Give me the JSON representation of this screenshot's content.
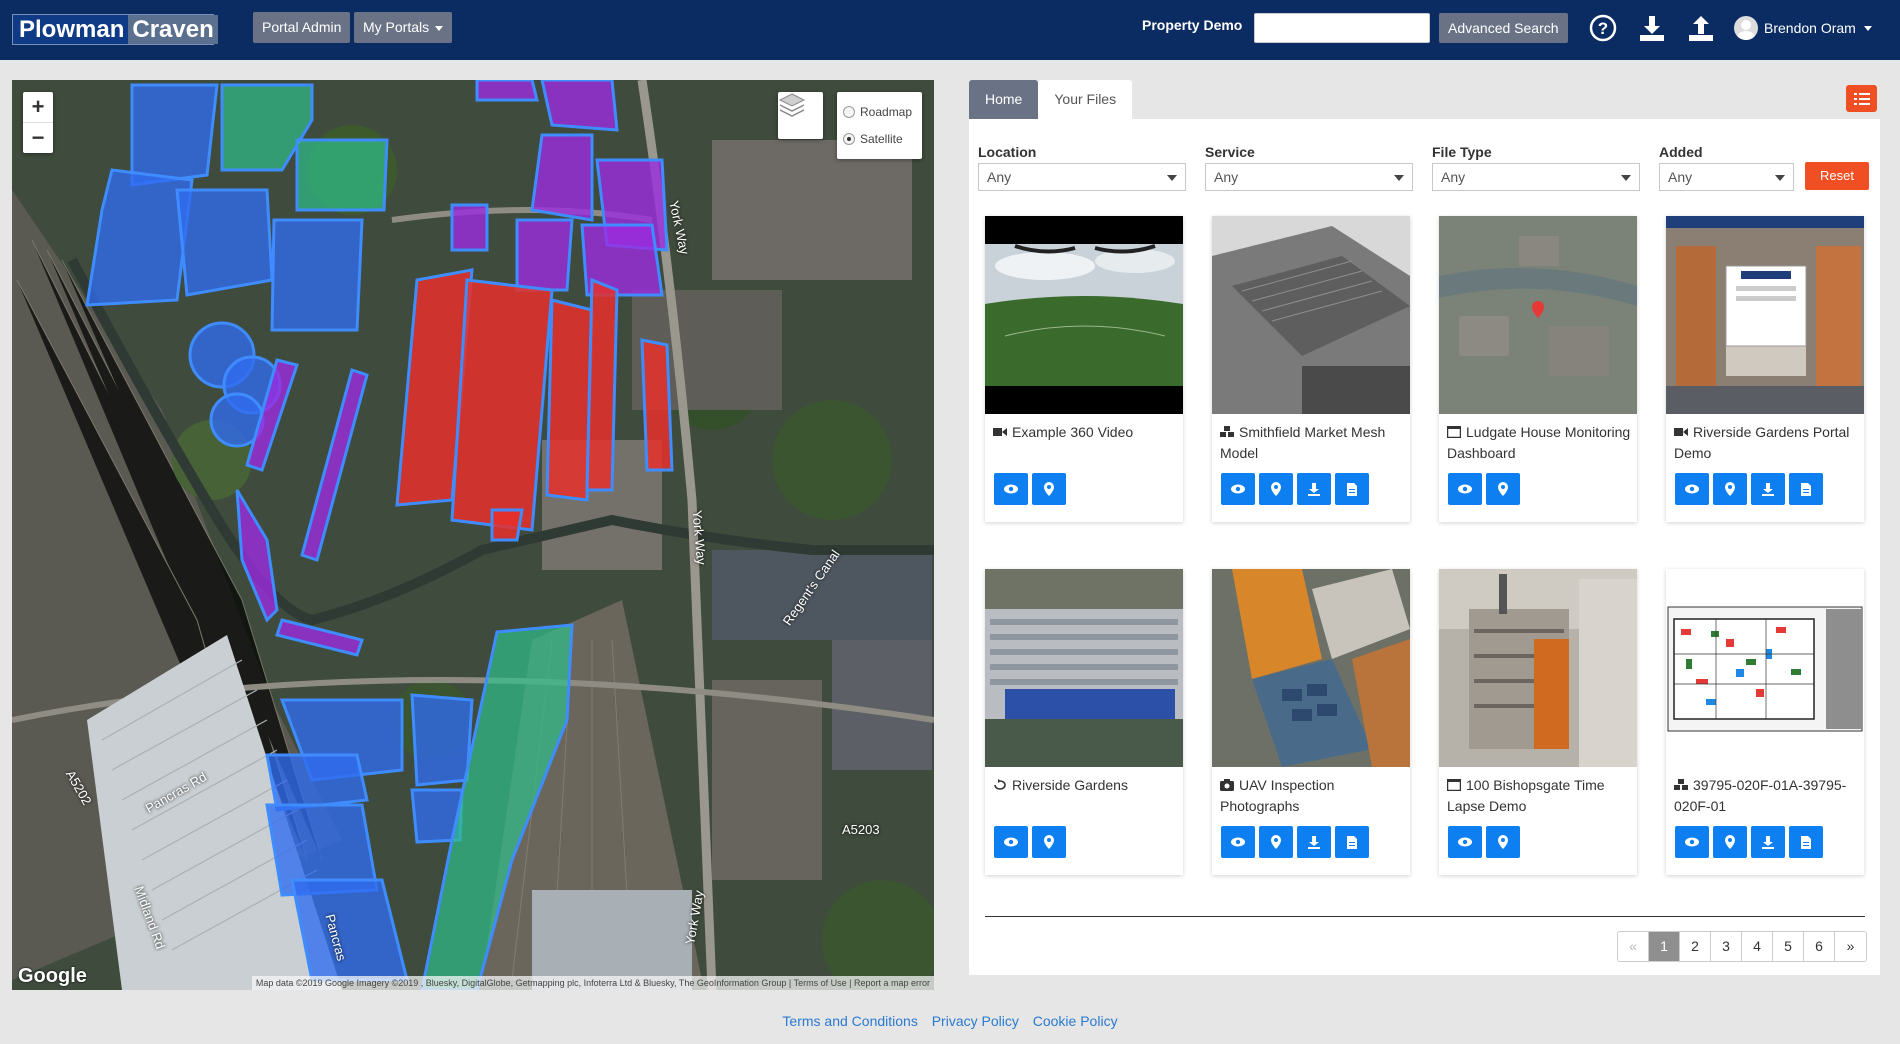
{
  "header": {
    "logo_word1": "Plowman",
    "logo_word2": "Craven",
    "portal_admin": "Portal Admin",
    "my_portals": "My Portals",
    "property_label": "Property Demo",
    "search_value": "",
    "advanced_search": "Advanced Search",
    "user_name": "Brendon Oram",
    "icons": [
      "help-icon",
      "download-icon",
      "upload-icon",
      "user-avatar-icon"
    ]
  },
  "map": {
    "zoom_in": "+",
    "zoom_out": "−",
    "layer_options": [
      "Roadmap",
      "Satellite"
    ],
    "selected_layer": "Satellite",
    "labels": [
      "York Way",
      "York Way",
      "York Way",
      "Regent's Canal",
      "A5203",
      "A5202",
      "Pancras Rd",
      "Midland Rd",
      "Pancras"
    ],
    "google": "Google",
    "attribution": "Map data ©2019 Google Imagery ©2019 , Bluesky, DigitalGlobe, Getmapping plc, Infoterra Ltd & Bluesky, The GeoInformation Group",
    "terms": "Terms of Use",
    "report": "Report a map error"
  },
  "tabs": [
    {
      "label": "Home",
      "active": true
    },
    {
      "label": "Your Files",
      "active": false
    }
  ],
  "filters": [
    {
      "label": "Location",
      "value": "Any"
    },
    {
      "label": "Service",
      "value": "Any"
    },
    {
      "label": "File Type",
      "value": "Any"
    },
    {
      "label": "Added",
      "value": "Any"
    }
  ],
  "reset_label": "Reset",
  "files": [
    {
      "title": "Example 360 Video",
      "icon": "video-icon",
      "actions": [
        "view",
        "locate"
      ]
    },
    {
      "title": "Smithfield Market Mesh Model",
      "icon": "cubes-icon",
      "actions": [
        "view",
        "locate",
        "download",
        "document"
      ]
    },
    {
      "title": "Ludgate House Monitoring Dashboard",
      "icon": "window-icon",
      "actions": [
        "view",
        "locate"
      ]
    },
    {
      "title": "Riverside Gardens Portal Demo",
      "icon": "video-icon",
      "actions": [
        "view",
        "locate",
        "download",
        "document"
      ]
    },
    {
      "title": "Riverside Gardens",
      "icon": "rotate-icon",
      "actions": [
        "view",
        "locate"
      ]
    },
    {
      "title": "UAV Inspection Photographs",
      "icon": "camera-icon",
      "actions": [
        "view",
        "locate",
        "download",
        "document"
      ]
    },
    {
      "title": "100 Bishopsgate Time Lapse Demo",
      "icon": "window-icon",
      "actions": [
        "view",
        "locate"
      ]
    },
    {
      "title": "39795-020F-01A-39795-020F-01",
      "icon": "cubes-icon",
      "actions": [
        "view",
        "locate",
        "download",
        "document"
      ]
    }
  ],
  "pagination": {
    "prev": "«",
    "pages": [
      "1",
      "2",
      "3",
      "4",
      "5",
      "6"
    ],
    "current": "1",
    "next": "»"
  },
  "footer": [
    "Terms and Conditions",
    "Privacy Policy",
    "Cookie Policy"
  ],
  "colors": {
    "header_bg": "#0b2b63",
    "accent_orange": "#f04e23",
    "action_blue": "#0d7ff0",
    "building_blue": "#2f6cf0",
    "building_red": "#e8302a",
    "building_purple": "#9b2ce0",
    "building_green": "#2fbf8a"
  }
}
